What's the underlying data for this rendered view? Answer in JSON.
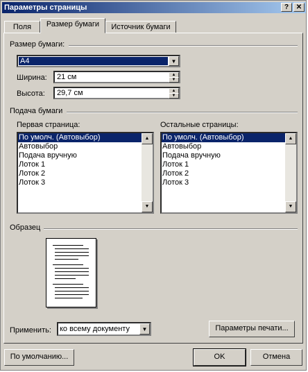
{
  "window": {
    "title": "Параметры страницы",
    "help_glyph": "?",
    "close_glyph": "✕"
  },
  "tabs": [
    {
      "label": "Поля"
    },
    {
      "label": "Размер бумаги"
    },
    {
      "label": "Источник бумаги"
    }
  ],
  "paper_size": {
    "group_label": "Размер бумаги:",
    "selected": "A4",
    "width_label": "Ширина:",
    "width_value": "21 см",
    "height_label": "Высота:",
    "height_value": "29,7 см"
  },
  "paper_source": {
    "group_label": "Подача бумаги",
    "first_page_label": "Первая страница:",
    "other_pages_label": "Остальные страницы:",
    "first_page_items": [
      "По умолч. (Автовыбор)",
      "Автовыбор",
      "Подача вручную",
      "Лоток 1",
      "Лоток 2",
      "Лоток 3"
    ],
    "other_pages_items": [
      "По умолч. (Автовыбор)",
      "Автовыбор",
      "Подача вручную",
      "Лоток 1",
      "Лоток 2",
      "Лоток 3"
    ]
  },
  "preview": {
    "group_label": "Образец"
  },
  "apply": {
    "label": "Применить:",
    "value": "ко всему документу"
  },
  "buttons": {
    "print_options": "Параметры печати...",
    "default": "По умолчанию...",
    "ok": "OK",
    "cancel": "Отмена"
  }
}
